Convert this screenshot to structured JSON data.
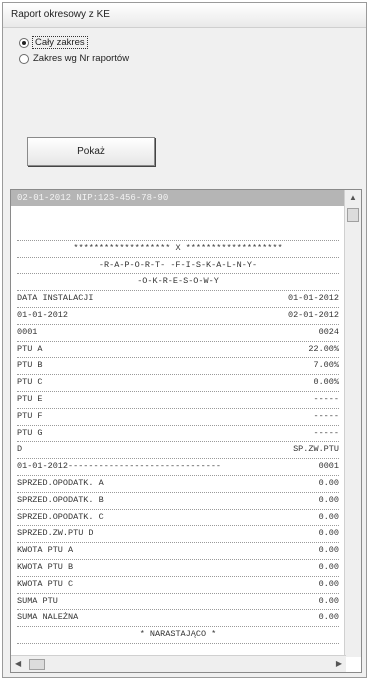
{
  "window": {
    "title": "Raport okresowy z KE"
  },
  "options": [
    {
      "label": "Cały zakres",
      "checked": true
    },
    {
      "label": "Zakres wg Nr raportów",
      "checked": false
    }
  ],
  "button": {
    "label": "Pokaż"
  },
  "receipt": {
    "header": "02-01-2012  NIP:123-456-78-90",
    "lines": [
      {
        "type": "sep",
        "text": ""
      },
      {
        "type": "center",
        "text": "******************* X *******************"
      },
      {
        "type": "center",
        "text": "-R-A-P-O-R-T- -F-I-S-K-A-L-N-Y-"
      },
      {
        "type": "center",
        "text": "-O-K-R-E-S-O-W-Y"
      },
      {
        "type": "kv",
        "left": "DATA INSTALACJI",
        "right": "01-01-2012"
      },
      {
        "type": "kv",
        "left": "01-01-2012",
        "right": "02-01-2012"
      },
      {
        "type": "kv",
        "left": "0001",
        "right": "0024"
      },
      {
        "type": "kv",
        "left": "PTU A",
        "right": "22.00%"
      },
      {
        "type": "kv",
        "left": "PTU B",
        "right": "7.00%"
      },
      {
        "type": "kv",
        "left": "PTU C",
        "right": "0.00%"
      },
      {
        "type": "kv",
        "left": "PTU E",
        "right": "-----"
      },
      {
        "type": "kv",
        "left": "PTU F",
        "right": "-----"
      },
      {
        "type": "kv",
        "left": "PTU G",
        "right": "-----"
      },
      {
        "type": "kv",
        "left": "D",
        "right": "SP.ZW.PTU"
      },
      {
        "type": "kv",
        "left": "01-01-2012------------------------------",
        "right": "0001"
      },
      {
        "type": "kv",
        "left": "SPRZED.OPODATK. A",
        "right": "0.00"
      },
      {
        "type": "kv",
        "left": "SPRZED.OPODATK. B",
        "right": "0.00"
      },
      {
        "type": "kv",
        "left": "SPRZED.OPODATK. C",
        "right": "0.00"
      },
      {
        "type": "kv",
        "left": "SPRZED.ZW.PTU D",
        "right": "0.00"
      },
      {
        "type": "kv",
        "left": "KWOTA PTU A",
        "right": "0.00"
      },
      {
        "type": "kv",
        "left": "KWOTA PTU B",
        "right": "0.00"
      },
      {
        "type": "kv",
        "left": "KWOTA PTU C",
        "right": "0.00"
      },
      {
        "type": "kv",
        "left": "SUMA PTU",
        "right": "0.00"
      },
      {
        "type": "kv",
        "left": "SUMA NALEŻNA",
        "right": "0.00"
      },
      {
        "type": "center",
        "text": "* NARASTAJĄCO *"
      }
    ]
  },
  "icons": {
    "scroll_up": "arrow-up-icon",
    "scroll_left": "arrow-left-icon",
    "scroll_right": "arrow-right-icon"
  }
}
